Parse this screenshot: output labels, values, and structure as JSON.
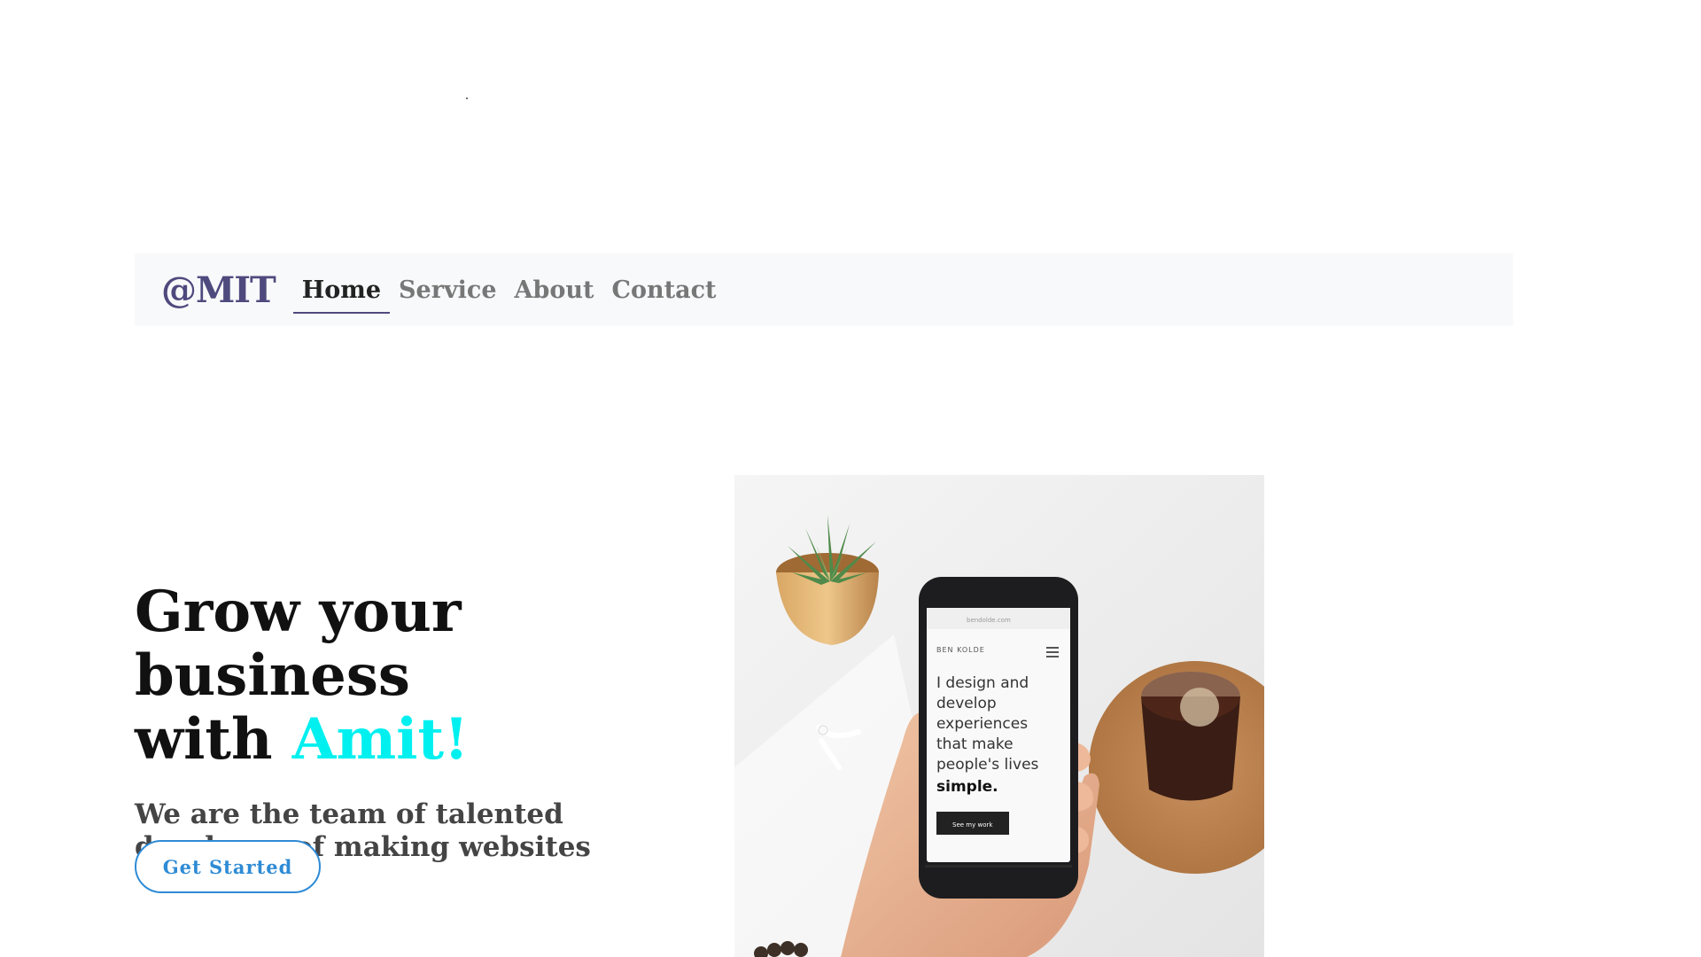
{
  "navbar": {
    "brand": "@MIT",
    "links": [
      {
        "label": "Home",
        "active": true
      },
      {
        "label": "Service",
        "active": false
      },
      {
        "label": "About",
        "active": false
      },
      {
        "label": "Contact",
        "active": false
      }
    ]
  },
  "hero": {
    "title_line1": "Grow your business",
    "title_line2_prefix": "with ",
    "title_accent": "Amit!",
    "subtitle": "We are the team of talented developer of making websites",
    "cta_label": "Get Started",
    "image": {
      "alt_icon": "hero-photo-phone",
      "phone_site_label": "BEN KOLDE",
      "phone_headline_lines": [
        "I design and",
        "develop",
        "experiences",
        "that make",
        "people's lives"
      ],
      "phone_headline_emphasis": "simple.",
      "phone_button_label": "See my work"
    }
  },
  "colors": {
    "brand": "#4e4a7e",
    "accent": "#00f0f0",
    "cta": "#2e8bd5",
    "navbar_bg": "#f8f9fa"
  }
}
